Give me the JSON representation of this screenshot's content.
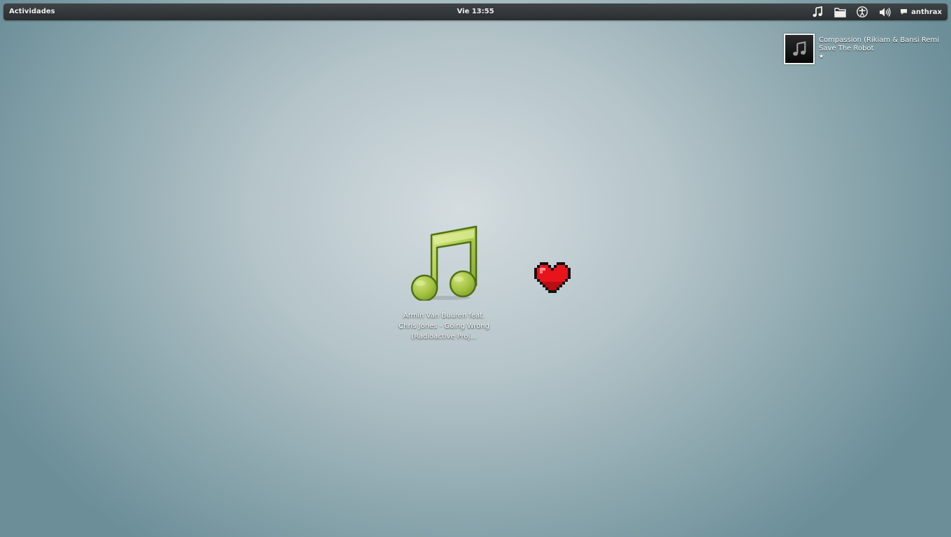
{
  "topbar": {
    "activities_label": "Actividades",
    "clock": "Vie 13:55",
    "tray_icons": [
      "music-note-icon",
      "folder-icon",
      "accessibility-icon",
      "volume-icon"
    ],
    "user_name": "anthrax",
    "colors": {
      "background": "#2e3234",
      "text": "#eeeeec"
    }
  },
  "notification": {
    "title": "Compassion (Rikiam & Bansi Remi",
    "artist": "Save The Robot",
    "rating": "★",
    "icon": "music-note-icon"
  },
  "desktop": {
    "music_file": {
      "icon": "music-note-icon",
      "label": "Armin Van Buuren feat. Chris Jones - Going Wrong (Radioactive Proj..."
    },
    "heart": {
      "icon": "heart-icon",
      "color": "#e8141b"
    }
  },
  "colors": {
    "wallpaper_center": "#d4dcdf",
    "wallpaper_edge": "#6b8e98",
    "music_icon_green": "#a9c84a"
  }
}
